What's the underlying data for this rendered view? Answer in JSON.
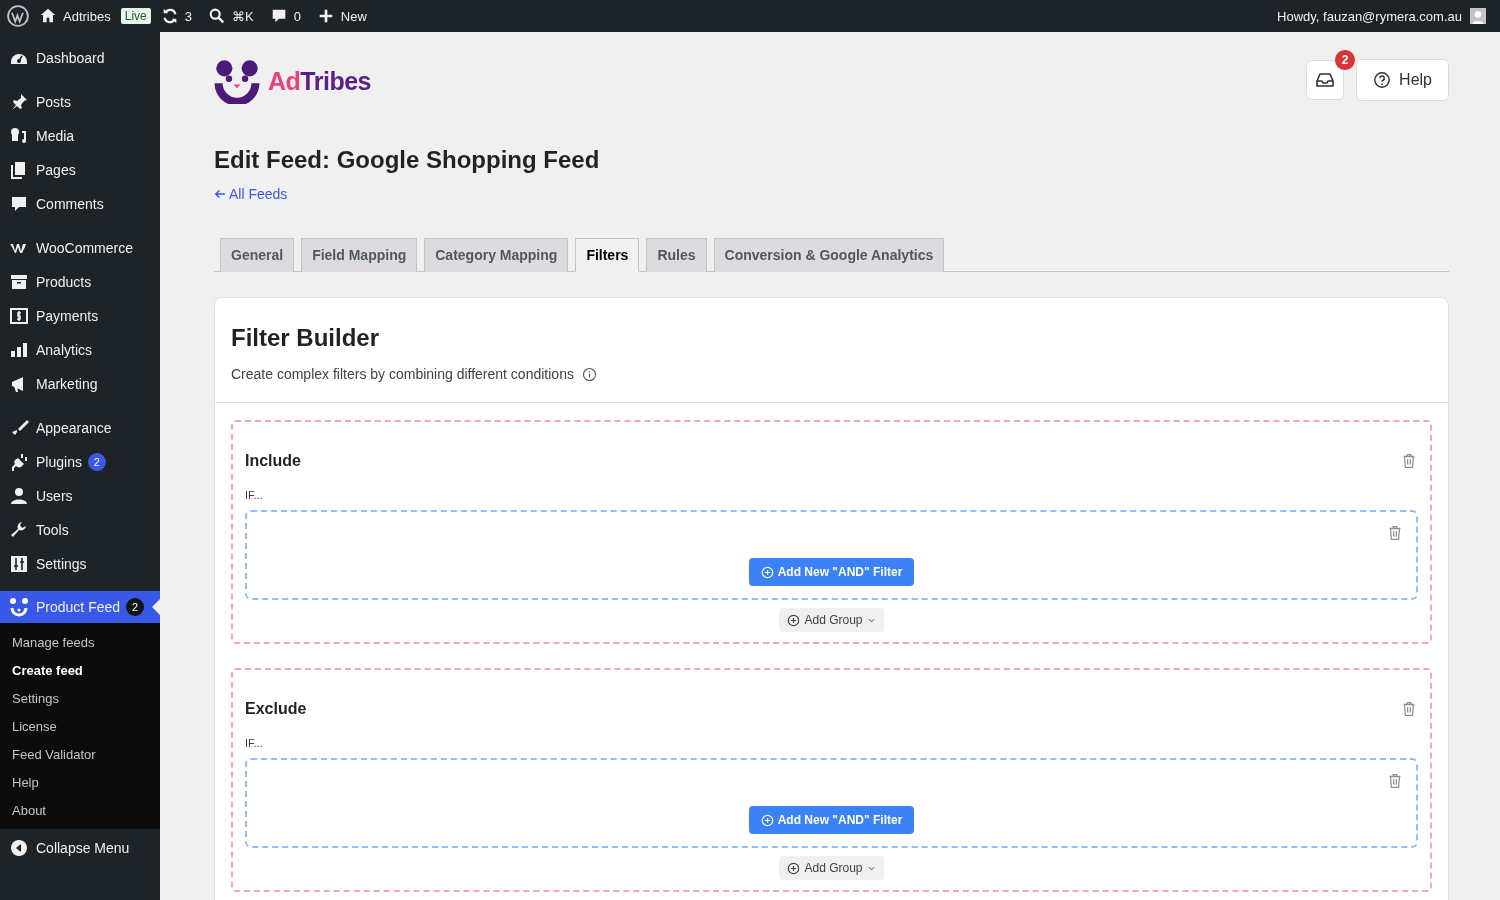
{
  "admin_bar": {
    "site": "Adtribes",
    "badge": "Live",
    "updates": "3",
    "search_shortcut": "⌘K",
    "comments": "0",
    "new": "New",
    "greeting": "Howdy, fauzan@rymera.com.au"
  },
  "sidebar": {
    "groups": [
      [
        {
          "label": "Dashboard",
          "selected": false
        }
      ],
      [
        {
          "label": "Posts",
          "selected": false
        },
        {
          "label": "Media",
          "selected": false
        },
        {
          "label": "Pages",
          "selected": false
        },
        {
          "label": "Comments",
          "selected": false
        }
      ],
      [
        {
          "label": "WooCommerce",
          "selected": false
        },
        {
          "label": "Products",
          "selected": false
        },
        {
          "label": "Payments",
          "selected": false
        },
        {
          "label": "Analytics",
          "selected": false
        },
        {
          "label": "Marketing",
          "selected": false
        }
      ],
      [
        {
          "label": "Appearance",
          "selected": false
        },
        {
          "label": "Plugins",
          "selected": false,
          "badge": "2"
        },
        {
          "label": "Users",
          "selected": false
        },
        {
          "label": "Tools",
          "selected": false
        },
        {
          "label": "Settings",
          "selected": false
        }
      ],
      [
        {
          "label": "Product Feed",
          "selected": true,
          "badge": "2",
          "submenu": [
            {
              "label": "Manage feeds",
              "selected": false
            },
            {
              "label": "Create feed",
              "selected": true
            },
            {
              "label": "Settings",
              "selected": false
            },
            {
              "label": "License",
              "selected": false
            },
            {
              "label": "Feed Validator",
              "selected": false
            },
            {
              "label": "Help",
              "selected": false
            },
            {
              "label": "About",
              "selected": false
            }
          ]
        }
      ]
    ],
    "collapse": "Collapse Menu"
  },
  "header": {
    "logo_first": "Ad",
    "logo_second": "Tribes",
    "notifications": "2",
    "help": "Help"
  },
  "page": {
    "title": "Edit Feed: Google Shopping Feed",
    "back_link": "All Feeds"
  },
  "tabs": [
    {
      "label": "General",
      "selected": false
    },
    {
      "label": "Field Mapping",
      "selected": false
    },
    {
      "label": "Category Mapping",
      "selected": false
    },
    {
      "label": "Filters",
      "selected": true
    },
    {
      "label": "Rules",
      "selected": false
    },
    {
      "label": "Conversion & Google Analytics",
      "selected": false
    }
  ],
  "filter_builder": {
    "title": "Filter Builder",
    "subtitle": "Create complex filters by combining different conditions",
    "sections": [
      {
        "title": "Include",
        "if_label": "IF...",
        "groups": [
          {
            "add_button": "Add New \"AND\" Filter"
          }
        ],
        "add_group": "Add Group"
      },
      {
        "title": "Exclude",
        "if_label": "IF...",
        "groups": [
          {
            "add_button": "Add New \"AND\" Filter"
          }
        ],
        "add_group": "Add Group"
      }
    ]
  }
}
